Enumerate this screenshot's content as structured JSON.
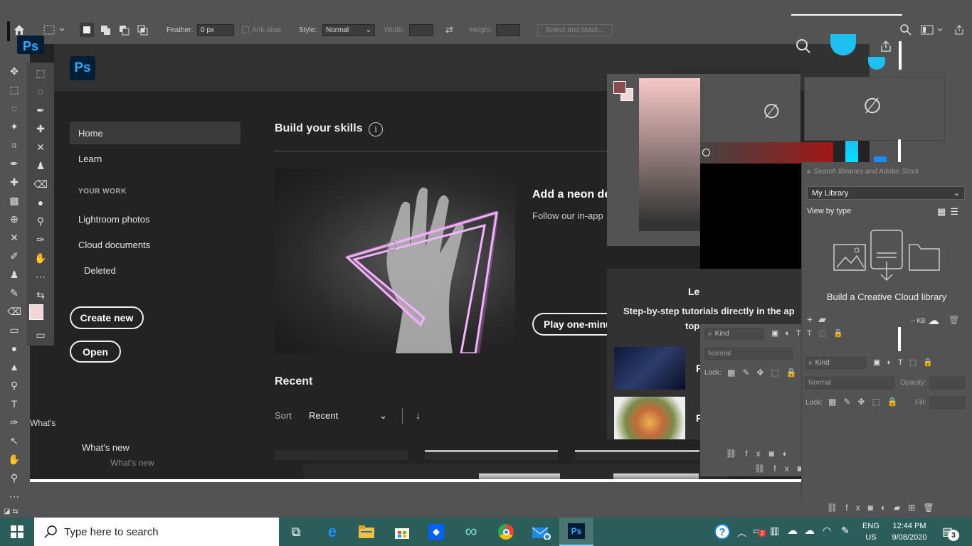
{
  "options_bar": {
    "feather_label": "Feather:",
    "feather_value": "0 px",
    "anti_alias_label": "Anti-alias",
    "style_label": "Style:",
    "style_value": "Normal",
    "width_label": "Width:",
    "height_label": "Height:",
    "select_mask_label": "Select and Mask..."
  },
  "app": {
    "logo_text": "Ps"
  },
  "sidebar": {
    "home": "Home",
    "learn": "Learn",
    "your_work_heading": "YOUR WORK",
    "lightroom": "Lightroom photos",
    "cloud_documents": "Cloud documents",
    "deleted": "Deleted",
    "create_new": "Create new",
    "open": "Open",
    "whats_new": "What's new",
    "whats_new_ghost": "What's new",
    "whats_new_partial": "What's"
  },
  "main": {
    "build_skills_title": "Build your skills",
    "card_title": "Add a neon de",
    "card_subtitle": "Follow our in-app ",
    "card_button": "Play one-minu",
    "recent_title": "Recent",
    "sort_label": "Sort",
    "sort_value": "Recent"
  },
  "learn_panel": {
    "title": "Le",
    "subtitle_1": "Step-by-step tutorials directly in the ap",
    "subtitle_2": "top",
    "item_letter_1": "F",
    "item_letter_2": "F"
  },
  "layers_panel_a": {
    "kind_label": "Kind",
    "blend_mode": "Normal",
    "lock_label": "Lock:"
  },
  "library_panel": {
    "search_placeholder": "Search libraries and Adobe Stock",
    "library_select": "My Library",
    "view_by": "View by type",
    "build_library": "Build a Creative Cloud library",
    "size_label": "-- KB"
  },
  "layers_panel_b": {
    "kind_label": "Kind",
    "blend_mode": "Normal",
    "opacity_label": "Opacity:",
    "lock_label": "Lock:",
    "fill_label": "Fill:"
  },
  "taskbar": {
    "search_placeholder": "Type here to search",
    "lang_1": "ENG",
    "lang_2": "US",
    "time": "12:44 PM",
    "date": "9/08/2020",
    "notif_count": "3",
    "badge_count": "2"
  },
  "colors": {
    "accent_blue": "#31a8ff",
    "ps_bg": "#001e36",
    "taskbar": "#2b5e5a",
    "color_picker_red": "#8b1a1a"
  }
}
